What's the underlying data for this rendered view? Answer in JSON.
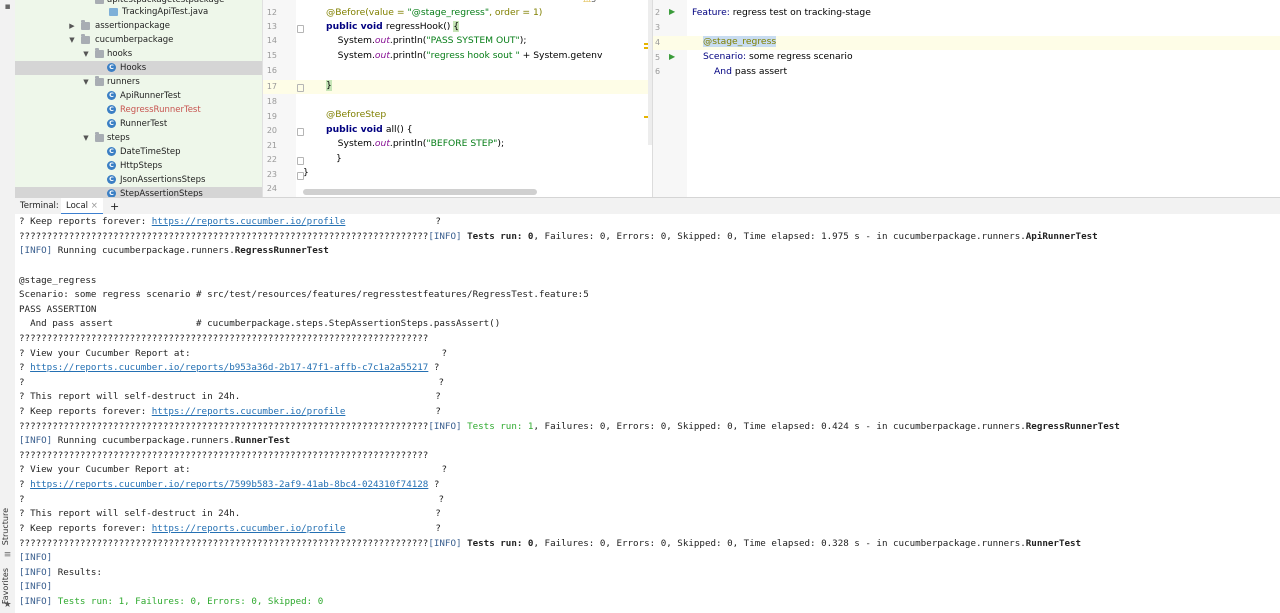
{
  "tool_strip": {
    "structure_label": "Structure",
    "favorites_label": "Favorites"
  },
  "project_tree": {
    "items": [
      {
        "label": "apitestpackagetestpackage"
      },
      {
        "label": "TrackingApiTest.java"
      },
      {
        "label": "assertionpackage"
      },
      {
        "label": "cucumberpackage"
      },
      {
        "label": "hooks"
      },
      {
        "label": "Hooks"
      },
      {
        "label": "runners"
      },
      {
        "label": "ApiRunnerTest"
      },
      {
        "label": "RegressRunnerTest"
      },
      {
        "label": "RunnerTest"
      },
      {
        "label": "steps"
      },
      {
        "label": "DateTimeStep"
      },
      {
        "label": "HttpSteps"
      },
      {
        "label": "JsonAssertionsSteps"
      },
      {
        "label": "StepAssertionSteps"
      }
    ],
    "class_icon_letter": "C",
    "warning_count": "5"
  },
  "code_editor": {
    "line_numbers": [
      "12",
      "13",
      "14",
      "15",
      "16",
      "17",
      "18",
      "19",
      "20",
      "21",
      "22",
      "23",
      "24"
    ],
    "lines": {
      "l12_ann": "@Before(value = ",
      "l12_str": "\"@stage_regress\"",
      "l12_rest": ", order = 1)",
      "l13_kw": "public void ",
      "l13_rest": "regressHook() ",
      "l13_brace": "{",
      "l14_a": "    System.",
      "l14_fld": "out",
      "l14_b": ".println(",
      "l14_str": "\"PASS SYSTEM OUT\"",
      "l14_c": ");",
      "l15_a": "    System.",
      "l15_fld": "out",
      "l15_b": ".println(",
      "l15_str": "\"regress hook sout \"",
      "l15_c": " + System.getenv",
      "l17_brace": "}",
      "l19_ann": "@BeforeStep",
      "l20_kw": "public void ",
      "l20_rest": "all() {",
      "l21_a": "    System.",
      "l21_fld": "out",
      "l21_b": ".println(",
      "l21_str": "\"BEFORE STEP\"",
      "l21_c": ");",
      "l22": "}",
      "l23": "}"
    }
  },
  "feature_editor": {
    "line_numbers": [
      "2",
      "3",
      "4",
      "5",
      "6"
    ],
    "run_glyph": "▶",
    "lines": {
      "l2_kw": "Feature:",
      "l2_rest": " regress test on tracking-stage",
      "l4_tag": "@stage_regress",
      "l5_kw": "Scenario:",
      "l5_rest": " some regress scenario",
      "l6_kw": "And",
      "l6_rest": " pass assert"
    }
  },
  "terminal_tabs": {
    "terminal_label": "Terminal:",
    "local_tab": "Local",
    "close_glyph": "×",
    "add_glyph": "+"
  },
  "terminal": {
    "keep_prefix": "? Keep reports forever: ",
    "profile_link": "https://reports.cucumber.io/profile",
    "q_end": "?",
    "q_bar": "??????????????????????????????????????????????????????????????????????????",
    "info": "[INFO]",
    "tests_run_0": "Tests run: 0",
    "tests_run_1": "Tests run: 1",
    "summary_rest_1": ", Failures: 0, Errors: 0, Skipped: 0, Time elapsed: 1.975 s - in cucumberpackage.runners.",
    "runner_1": "ApiRunnerTest",
    "running_prefix": " Running cucumberpackage.runners.",
    "regress_runner": "RegressRunnerTest",
    "tag_line": "@stage_regress",
    "scenario_line": "Scenario: some regress scenario # src/test/resources/features/regresstestfeatures/RegressTest.feature:5",
    "pass_assertion": "PASS ASSERTION",
    "and_line": "  And pass assert               # cucumberpackage.steps.StepAssertionSteps.passAssert()",
    "view_report": "? View your Cucumber Report at:",
    "q_prefix": "? ",
    "report_link_1": "https://reports.cucumber.io/reports/b953a36d-2b17-47f1-affb-c7c1a2a55217",
    "self_destruct": "? This report will self-destruct in 24h.",
    "summary_rest_2": ", Failures: 0, Errors: 0, Skipped: 0, Time elapsed: 0.424 s - in cucumberpackage.runners.",
    "runner_test": "RunnerTest",
    "report_link_2": "https://reports.cucumber.io/reports/7599b583-2af9-41ab-8bc4-024310f74128",
    "summary_rest_3": ", Failures: 0, Errors: 0, Skipped: 0, Time elapsed: 0.328 s - in cucumberpackage.runners.",
    "results": " Results:",
    "final_results": " Tests run: 1, Failures: 0, Errors: 0, Skipped: 0"
  }
}
